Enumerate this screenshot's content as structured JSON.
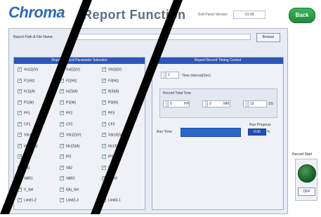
{
  "header": {
    "brand": "Chroma",
    "title": "Report Function",
    "soft_panel_label": "Soft Panel Version:",
    "soft_panel_value": "V3.00",
    "back_label": "Back"
  },
  "path": {
    "label": "Report Path & File Name:",
    "value": "C:\\",
    "browse_label": "Browse"
  },
  "params_panel": {
    "title": "Report Record Parameter Selection",
    "items": [
      [
        "Vrs(1)(V)",
        "Vst(2)(V)",
        "Vtr(3)(V)"
      ],
      [
        "F1(Hz)",
        "F2(Hz)",
        "F3(Hz)"
      ],
      [
        "Ir(1)(A)",
        "Is(2)(A)",
        "It(3)(A)"
      ],
      [
        "P1(W)",
        "P2(W)",
        "P3(W)"
      ],
      [
        "PF1",
        "PF2",
        "PF3"
      ],
      [
        "CF1",
        "CF2",
        "CF3"
      ],
      [
        "Vdc(1)(V)",
        "Vdc(2)(V)",
        "Vdc(3)(V)"
      ],
      [
        "Idc(1)(A)",
        "Idc(2)(A)",
        "Idc(3)(A)"
      ],
      [
        "IP1",
        "IP2",
        "IP3"
      ],
      [
        "VA1",
        "VA2",
        "VA3"
      ],
      [
        "VAR1",
        "VAR2",
        "VAR3"
      ],
      [
        "V_Sel",
        "I(A)_Sel",
        ""
      ],
      [
        "Limit1-2",
        "Limit2-3",
        "Limit3-1"
      ]
    ]
  },
  "timing_panel": {
    "title": "Report Record Timing Control",
    "interval_value": "1",
    "interval_label": "Time Interval(Sec):",
    "total_time_label": "Record Total Time",
    "hh_value": "0",
    "mm_value": "0",
    "ss_value": "10",
    "hh_label": "HH",
    "mm_label": "MM",
    "ss_label": "SS",
    "run_time_label": "Run Time:",
    "progress_label": "Run Progress",
    "progress_value": "0.00",
    "progress_unit": "%"
  },
  "record": {
    "start_label": "Record Start",
    "off_label": "OFF"
  }
}
